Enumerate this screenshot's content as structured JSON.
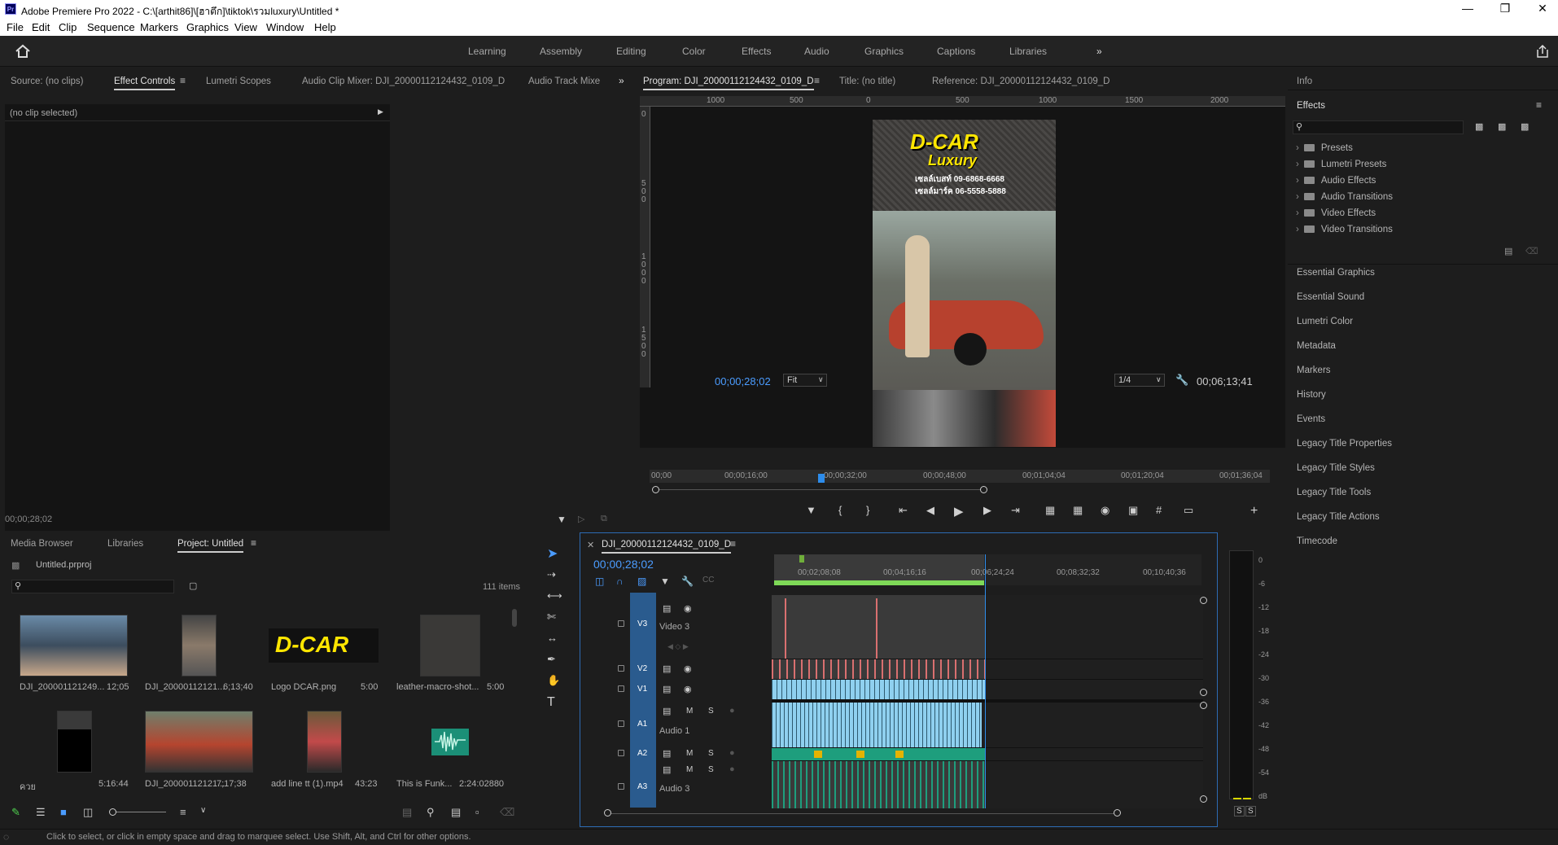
{
  "titlebar": {
    "logo": "Pr",
    "title": "Adobe Premiere Pro 2022 - C:\\[arthit86]\\[ฮาตึก]\\tiktok\\รวมluxury\\Untitled *"
  },
  "menu": [
    "File",
    "Edit",
    "Clip",
    "Sequence",
    "Markers",
    "Graphics",
    "View",
    "Window",
    "Help"
  ],
  "workspaces": [
    "Learning",
    "Assembly",
    "Editing",
    "Color",
    "Effects",
    "Audio",
    "Graphics",
    "Captions",
    "Libraries"
  ],
  "source_panel": {
    "tabs": [
      "Source: (no clips)",
      "Effect Controls",
      "Lumetri Scopes",
      "Audio Clip Mixer: DJI_20000112124432_0109_D",
      "Audio Track Mixe"
    ],
    "no_clip": "(no clip selected)",
    "timecode": "00;00;28;02"
  },
  "program_panel": {
    "tabs": [
      "Program: DJI_20000112124432_0109_D",
      "Title: (no title)",
      "Reference: DJI_20000112124432_0109_D"
    ],
    "ruler": [
      "1000",
      "500",
      "0",
      "500",
      "1000",
      "1500",
      "2000"
    ],
    "vruler": [
      "0",
      "5 0 0",
      "1 0 0 0",
      "1 5 0 0"
    ],
    "timecode": "00;00;28;02",
    "fit": "Fit",
    "quality": "1/4",
    "duration": "00;06;13;41",
    "scrub_ticks": [
      "00;00",
      "00;00;16;00",
      "00;00;32;00",
      "00;00;48;00",
      "00;01;04;04",
      "00;01;20;04",
      "00;01;36;04"
    ],
    "frame": {
      "logo": "D-CAR",
      "logo2": "Luxury",
      "line1": "เซลล์เบสท์ 09-6868-6668",
      "line2": "เซลล์มาร์ค 06-5558-5888"
    }
  },
  "right_panel": {
    "info": "Info",
    "effects": "Effects",
    "effects_tree": [
      "Presets",
      "Lumetri Presets",
      "Audio Effects",
      "Audio Transitions",
      "Video Effects",
      "Video Transitions"
    ],
    "list": [
      "Essential Graphics",
      "Essential Sound",
      "Lumetri Color",
      "Metadata",
      "Markers",
      "History",
      "Events",
      "Legacy Title Properties",
      "Legacy Title Styles",
      "Legacy Title Tools",
      "Legacy Title Actions",
      "Timecode"
    ]
  },
  "project_panel": {
    "tabs": [
      "Media Browser",
      "Libraries",
      "Project: Untitled"
    ],
    "file": "Untitled.prproj",
    "count": "111 items",
    "items": [
      {
        "name": "DJI_200001121249...",
        "dur": "12;05"
      },
      {
        "name": "DJI_20000112121...",
        "dur": "6;13;40"
      },
      {
        "name": "Logo DCAR.png",
        "dur": "5:00"
      },
      {
        "name": "leather-macro-shot...",
        "dur": "5:00"
      },
      {
        "name": "ควย",
        "dur": "5:16:44"
      },
      {
        "name": "DJI_20000112121...",
        "dur": "7;17;38"
      },
      {
        "name": "add line tt (1).mp4",
        "dur": "43:23"
      },
      {
        "name": "This is Funk...",
        "dur": "2:24:02880"
      }
    ],
    "logo_text": "D-CAR"
  },
  "timeline": {
    "tab": "DJI_20000112124432_0109_D",
    "timecode": "00;00;28;02",
    "ruler": [
      "00;02;08;08",
      "00;04;16;16",
      "00;06;24;24",
      "00;08;32;32",
      "00;10;40;36"
    ],
    "tracks": [
      {
        "id": "V3",
        "name": "Video 3"
      },
      {
        "id": "V2",
        "name": ""
      },
      {
        "id": "V1",
        "name": ""
      },
      {
        "id": "A1",
        "name": "Audio 1"
      },
      {
        "id": "A2",
        "name": ""
      },
      {
        "id": "A3",
        "name": "Audio 3"
      }
    ],
    "btn_m": "M",
    "btn_s": "S"
  },
  "meter": {
    "labels": [
      "0",
      "-6",
      "-12",
      "-18",
      "-24",
      "-30",
      "-36",
      "-42",
      "-48",
      "-54",
      "dB"
    ],
    "solo": [
      "S",
      "S"
    ]
  },
  "status": "Click to select, or click in empty space and drag to marquee select. Use Shift, Alt, and Ctrl for other options.",
  "colors": {
    "accent": "#2d8ceb",
    "video_clip": "#8fd0ef",
    "audio_clip": "#1e9e7d",
    "v3_clip": "#d97070"
  }
}
